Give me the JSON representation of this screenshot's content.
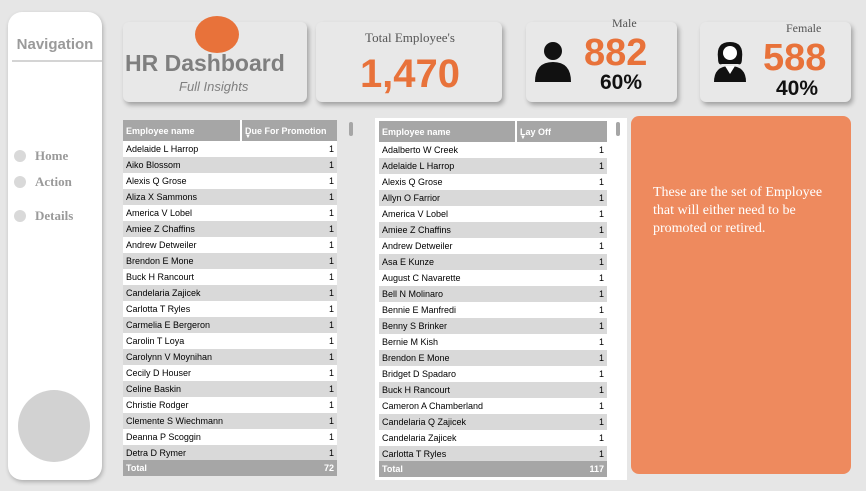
{
  "navigation": {
    "title": "Navigation",
    "items": [
      {
        "label": "Home"
      },
      {
        "label": "Action"
      },
      {
        "label": "Details"
      }
    ]
  },
  "header": {
    "title": "HR Dashboard",
    "subtitle": "Full Insights"
  },
  "kpi": {
    "total": {
      "label": "Total Employee's",
      "value": "1,470"
    },
    "male": {
      "label": "Male",
      "count": "882",
      "percent": "60%"
    },
    "female": {
      "label": "Female",
      "count": "588",
      "percent": "40%"
    }
  },
  "colors": {
    "accent": "#e8723a",
    "info_bg": "#ee8a5e",
    "table_header": "#a6a6a6",
    "row_alt": "#d9d9d9"
  },
  "promotion_table": {
    "columns": [
      "Employee name",
      "Due For Promotion"
    ],
    "rows": [
      [
        "Adelaide L Harrop",
        "1"
      ],
      [
        "Aiko Blossom",
        "1"
      ],
      [
        "Alexis Q Grose",
        "1"
      ],
      [
        "Aliza X Sammons",
        "1"
      ],
      [
        "America V Lobel",
        "1"
      ],
      [
        "Amiee Z Chaffins",
        "1"
      ],
      [
        "Andrew Detweiler",
        "1"
      ],
      [
        "Brendon E Mone",
        "1"
      ],
      [
        "Buck H Rancourt",
        "1"
      ],
      [
        "Candelaria Zajicek",
        "1"
      ],
      [
        "Carlotta T Ryles",
        "1"
      ],
      [
        "Carmelia E Bergeron",
        "1"
      ],
      [
        "Carolin T Loya",
        "1"
      ],
      [
        "Carolynn V Moynihan",
        "1"
      ],
      [
        "Cecily D Houser",
        "1"
      ],
      [
        "Celine Baskin",
        "1"
      ],
      [
        "Christie Rodger",
        "1"
      ],
      [
        "Clemente S Wiechmann",
        "1"
      ],
      [
        "Deanna P Scoggin",
        "1"
      ],
      [
        "Detra D Rymer",
        "1"
      ]
    ],
    "total_label": "Total",
    "total_value": "72"
  },
  "layoff_table": {
    "columns": [
      "Employee name",
      "Lay Off"
    ],
    "rows": [
      [
        "Adalberto W Creek",
        "1"
      ],
      [
        "Adelaide L Harrop",
        "1"
      ],
      [
        "Alexis Q Grose",
        "1"
      ],
      [
        "Allyn O Farrior",
        "1"
      ],
      [
        "America V Lobel",
        "1"
      ],
      [
        "Amiee Z Chaffins",
        "1"
      ],
      [
        "Andrew Detweiler",
        "1"
      ],
      [
        "Asa E Kunze",
        "1"
      ],
      [
        "August C Navarette",
        "1"
      ],
      [
        "Bell N Molinaro",
        "1"
      ],
      [
        "Bennie E Manfredi",
        "1"
      ],
      [
        "Benny S Brinker",
        "1"
      ],
      [
        "Bernie M Kish",
        "1"
      ],
      [
        "Brendon E Mone",
        "1"
      ],
      [
        "Bridget D Spadaro",
        "1"
      ],
      [
        "Buck H Rancourt",
        "1"
      ],
      [
        "Cameron A Chamberland",
        "1"
      ],
      [
        "Candelaria Q Zajicek",
        "1"
      ],
      [
        "Candelaria Zajicek",
        "1"
      ],
      [
        "Carlotta T Ryles",
        "1"
      ]
    ],
    "total_label": "Total",
    "total_value": "117"
  },
  "info": {
    "text": "These are the set of Employee that will either need to be promoted or retired."
  }
}
